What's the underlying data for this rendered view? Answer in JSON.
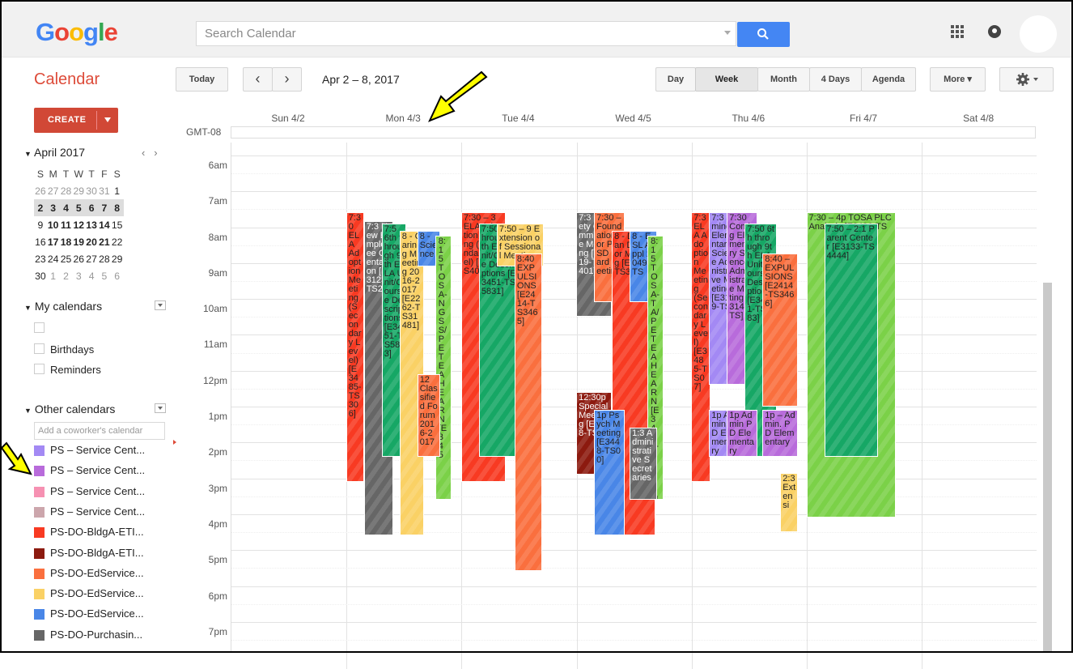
{
  "header": {
    "logo": "Google",
    "search_placeholder": "Search Calendar",
    "search_icon": "search-icon",
    "apps_icon": "apps-grid-icon",
    "notifications_icon": "bell-icon"
  },
  "toolbar": {
    "title": "Calendar",
    "today": "Today",
    "prev": "‹",
    "next": "›",
    "date_range": "Apr 2 – 8, 2017",
    "views": [
      "Day",
      "Week",
      "Month",
      "4 Days",
      "Agenda"
    ],
    "selected_view": "Week",
    "more": "More ▾",
    "settings_icon": "gear-icon"
  },
  "sidebar": {
    "create": "CREATE",
    "mini_month": "April 2017",
    "weekday_headers": [
      "S",
      "M",
      "T",
      "W",
      "T",
      "F",
      "S"
    ],
    "weeks": [
      [
        "26",
        "27",
        "28",
        "29",
        "30",
        "31",
        "1"
      ],
      [
        "2",
        "3",
        "4",
        "5",
        "6",
        "7",
        "8"
      ],
      [
        "9",
        "10",
        "11",
        "12",
        "13",
        "14",
        "15"
      ],
      [
        "16",
        "17",
        "18",
        "19",
        "20",
        "21",
        "22"
      ],
      [
        "23",
        "24",
        "25",
        "26",
        "27",
        "28",
        "29"
      ],
      [
        "30",
        "1",
        "2",
        "3",
        "4",
        "5",
        "6"
      ]
    ],
    "my_calendars_title": "My calendars",
    "my_calendars": [
      "",
      "Birthdays",
      "Reminders"
    ],
    "other_calendars_title": "Other calendars",
    "add_coworker_placeholder": "Add a coworker's calendar",
    "other_calendars": [
      {
        "label": "PS – Service Cent...",
        "color": "#a389f4"
      },
      {
        "label": "PS – Service Cent...",
        "color": "#b86bdb"
      },
      {
        "label": "PS – Service Cent...",
        "color": "#f691b2"
      },
      {
        "label": "PS – Service Cent...",
        "color": "#cca6ac"
      },
      {
        "label": "PS-DO-BldgA-ETI...",
        "color": "#f83a22"
      },
      {
        "label": "PS-DO-BldgA-ETI...",
        "color": "#8c1a0f"
      },
      {
        "label": "PS-DO-EdService...",
        "color": "#fa6f3e"
      },
      {
        "label": "PS-DO-EdService...",
        "color": "#fad165"
      },
      {
        "label": "PS-DO-EdService...",
        "color": "#4986e7"
      },
      {
        "label": "PS-DO-Purchasin...",
        "color": "#666666"
      }
    ]
  },
  "week": {
    "timezone": "GMT-08",
    "days": [
      "Sun 4/2",
      "Mon 4/3",
      "Tue 4/4",
      "Wed 4/5",
      "Thu 4/6",
      "Fri 4/7",
      "Sat 4/8"
    ],
    "hours": [
      "6am",
      "7am",
      "8am",
      "9am",
      "10am",
      "11am",
      "12pm",
      "1pm",
      "2pm",
      "3pm",
      "4pm",
      "5pm",
      "6pm",
      "7pm"
    ]
  },
  "events": [
    {
      "text": "7:30 ELA Adoption Meeting (Secondary Level) [E3485-TS306]",
      "color": "#f83a22",
      "day": 1,
      "start": 7.5,
      "end": 15.0,
      "col": 0
    },
    {
      "text": "7:3 New Employee Orientation [E3123-TS23",
      "color": "#666666",
      "day": 1,
      "start": 7.75,
      "end": 16.5,
      "col": 1
    },
    {
      "text": "7:5 6th through 9th ELA Unit/Course Descriptions [E3451-TS583]",
      "color": "#16a765",
      "day": 1,
      "start": 7.8,
      "end": 14.3,
      "col": 2
    },
    {
      "text": "8 - Caring Meeting 2016-2017 [E2262-TS31481]",
      "color": "#fad165",
      "day": 1,
      "start": 8.0,
      "end": 16.5,
      "col": 3
    },
    {
      "text": "8 - Science",
      "color": "#4986e7",
      "day": 1,
      "start": 8.0,
      "end": 9.0,
      "col": 4
    },
    {
      "text": "8:15 TOSA-NGSS/PETE AHEARN[E345",
      "color": "#7bd148",
      "day": 1,
      "start": 8.15,
      "end": 15.5,
      "col": 5,
      "vertical": true
    },
    {
      "text": "12 Classified Forum 2016-2017",
      "color": "#fa6f3e",
      "day": 1,
      "start": 12.0,
      "end": 14.3,
      "col": 4
    },
    {
      "text": "7:30 – 3 ELA Adoption Meeting (Secondary Level) [E28-TS40]",
      "color": "#f83a22",
      "day": 2,
      "start": 7.5,
      "end": 15.0,
      "col": 0
    },
    {
      "text": "7:50 6th through 9th ELA Unit/Course Descriptions [E3451-TS5831]",
      "color": "#16a765",
      "day": 2,
      "start": 7.8,
      "end": 14.3,
      "col": 1
    },
    {
      "text": "7:50 – 9 Extension of Sessional Meeting",
      "color": "#fad165",
      "day": 2,
      "start": 7.8,
      "end": 9.0,
      "col": 2
    },
    {
      "text": "8:40 EXPULSIONS [E2414-TS3465]",
      "color": "#fa6f3e",
      "day": 2,
      "start": 8.65,
      "end": 17.5,
      "col": 3
    },
    {
      "text": "7:3 Safety Committee Meeting [E3519-TS4401]",
      "color": "#666666",
      "day": 3,
      "start": 7.5,
      "end": 10.4,
      "col": 0
    },
    {
      "text": "7:30 – Foundation for PSSD Board Meeting",
      "color": "#fa6f3e",
      "day": 3,
      "start": 7.5,
      "end": 10.0,
      "col": 1
    },
    {
      "text": "8 - Deregan Director Meeting [E3398-TS3830]",
      "color": "#f83a22",
      "day": 3,
      "start": 8.0,
      "end": 16.5,
      "col": 2
    },
    {
      "text": "8 - ESL Appl 2049-TS",
      "color": "#4986e7",
      "day": 3,
      "start": 8.0,
      "end": 10.0,
      "col": 3
    },
    {
      "text": "8:15 TOSA-TA/PETE AHEARN [E3455-TS5726]",
      "color": "#7bd148",
      "day": 3,
      "start": 8.15,
      "end": 15.5,
      "col": 4,
      "vertical": true
    },
    {
      "text": "12:30p Special Meeting [E3448-TS]",
      "color": "#8c1a0f",
      "day": 3,
      "start": 12.5,
      "end": 14.8,
      "col": 0
    },
    {
      "text": "1p Psych Meeting [E3448-TS00]",
      "color": "#4986e7",
      "day": 3,
      "start": 13.0,
      "end": 16.5,
      "col": 1
    },
    {
      "text": "1:3 Administrative Secretaries",
      "color": "#666666",
      "day": 3,
      "start": 13.5,
      "end": 15.5,
      "col": 3
    },
    {
      "text": "7:3 ELA Adoption Meeting (Secondary Level) [E3485-TS07]",
      "color": "#f83a22",
      "day": 4,
      "start": 7.5,
      "end": 15.0,
      "col": 0
    },
    {
      "text": "7:3 Coming Elementary Science Administrative Meeting [E3149-TS]",
      "color": "#a389f4",
      "day": 4,
      "start": 7.5,
      "end": 12.3,
      "col": 1
    },
    {
      "text": "7:30 Coming Elementary Science Administrative Meeting [E3149-TS]",
      "color": "#b86bdb",
      "day": 4,
      "start": 7.5,
      "end": 12.3,
      "col": 2
    },
    {
      "text": "7:50 6th through 9th ELA Unit/Course Descriptions [E3451-TS583]",
      "color": "#16a765",
      "day": 4,
      "start": 7.8,
      "end": 14.3,
      "col": 3
    },
    {
      "text": "8:40 – EXPULSIONS [E2414-TS3466]",
      "color": "#fa6f3e",
      "day": 4,
      "start": 8.65,
      "end": 12.9,
      "col": 4
    },
    {
      "text": "1p Admin PD Elementary",
      "color": "#a389f4",
      "day": 4,
      "start": 13.0,
      "end": 14.3,
      "col": 1
    },
    {
      "text": "1p Admin PD Elementary",
      "color": "#b86bdb",
      "day": 4,
      "start": 13.0,
      "end": 14.3,
      "col": 2
    },
    {
      "text": "1p – Admin. PD Elementary",
      "color": "#b86bdb",
      "day": 4,
      "start": 13.0,
      "end": 14.3,
      "col": 4
    },
    {
      "text": "2:3 Extensi",
      "color": "#fad165",
      "day": 4,
      "start": 14.75,
      "end": 16.4,
      "col": 5
    },
    {
      "text": "7:30 – 4p TOSA PLC Analysis [E3486-TS",
      "color": "#7bd148",
      "day": 5,
      "start": 7.5,
      "end": 16.0,
      "col": 0
    },
    {
      "text": "7:50 – 2:1 Parent Center [E3133-TS4444]",
      "color": "#16a765",
      "day": 5,
      "start": 7.8,
      "end": 14.3,
      "col": 1
    }
  ]
}
